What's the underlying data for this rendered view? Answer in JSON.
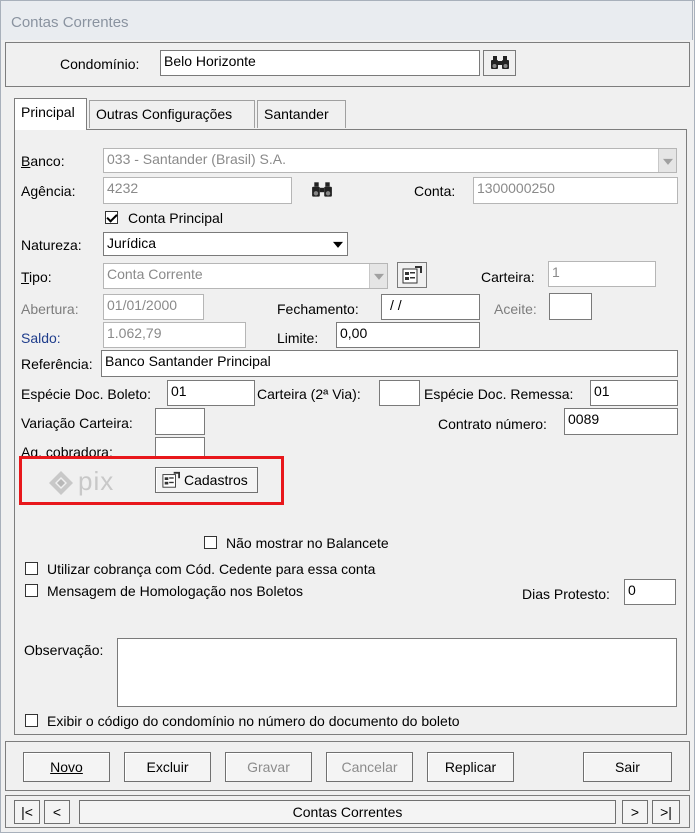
{
  "window": {
    "title": "Contas Correntes"
  },
  "condominio": {
    "label": "Condomínio:",
    "value": "Belo Horizonte"
  },
  "tabs": [
    "Principal",
    "Outras Configurações",
    "Santander"
  ],
  "form": {
    "banco": {
      "label": "Banco:",
      "value": "033 - Santander (Brasil) S.A."
    },
    "agencia": {
      "label": "Agência:",
      "value": "4232"
    },
    "conta": {
      "label": "Conta:",
      "value": "1300000250"
    },
    "conta_principal": {
      "label": "Conta Principal",
      "checked": true
    },
    "natureza": {
      "label": "Natureza:",
      "value": "Jurídica"
    },
    "tipo": {
      "label": "Tipo:",
      "value": "Conta Corrente"
    },
    "carteira": {
      "label": "Carteira:",
      "value": "1"
    },
    "abertura": {
      "label": "Abertura:",
      "value": "01/01/2000"
    },
    "fechamento": {
      "label": "Fechamento:",
      "value": " / /"
    },
    "aceite": {
      "label": "Aceite:",
      "value": ""
    },
    "saldo": {
      "label": "Saldo:",
      "value": "1.062,79"
    },
    "limite": {
      "label": "Limite:",
      "value": "0,00"
    },
    "referencia": {
      "label": "Referência:",
      "value": "Banco Santander Principal"
    },
    "especie_doc_boleto": {
      "label": "Espécie Doc. Boleto:",
      "value": "01"
    },
    "carteira_2via": {
      "label": "Carteira (2ª Via):",
      "value": ""
    },
    "especie_doc_remessa": {
      "label": "Espécie Doc. Remessa:",
      "value": "01"
    },
    "variacao_carteira": {
      "label": "Variação Carteira:",
      "value": ""
    },
    "contrato_numero": {
      "label": "Contrato número:",
      "value": "0089"
    },
    "ag_cobradora": {
      "label": "Ag. cobradora:",
      "value": ""
    },
    "pix": {
      "logo_text": "pix",
      "cadastros_label": "Cadastros",
      "highlight_color": "#e8171b"
    },
    "nao_mostrar_balancete": {
      "label": "Não mostrar no Balancete",
      "checked": false
    },
    "utilizar_cobranca": {
      "label": "Utilizar cobrança com Cód. Cedente para essa conta",
      "checked": false
    },
    "mensagem_homologacao": {
      "label": "Mensagem de Homologação nos Boletos",
      "checked": false
    },
    "dias_protesto": {
      "label": "Dias Protesto:",
      "value": "0"
    },
    "observacao": {
      "label": "Observação:",
      "value": ""
    },
    "exibir_codigo": {
      "label": "Exibir o código do condomínio no número do documento do boleto",
      "checked": false
    }
  },
  "buttons": {
    "novo": "Novo",
    "excluir": "Excluir",
    "gravar": "Gravar",
    "cancelar": "Cancelar",
    "replicar": "Replicar",
    "sair": "Sair"
  },
  "navigator": {
    "first": "|<",
    "prev": "<",
    "label": "Contas Correntes",
    "next": ">",
    "last": ">|"
  }
}
